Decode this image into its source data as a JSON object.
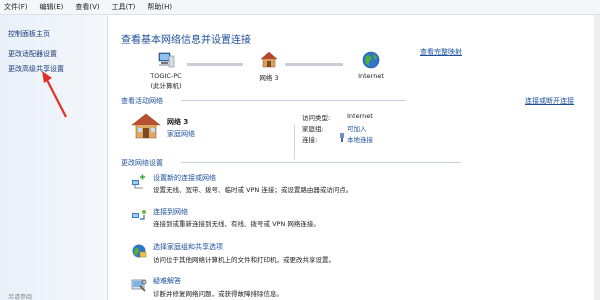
{
  "menu": {
    "file": "文件(F)",
    "edit": "编辑(E)",
    "view": "查看(V)",
    "tools": "工具(T)",
    "help": "帮助(H)"
  },
  "sidebar": {
    "home": "控制面板主页",
    "adapter": "更改适配器设置",
    "advanced_sharing": "更改高级共享设置",
    "see_also": "另请参阅"
  },
  "main": {
    "title": "查看基本网络信息并设置连接",
    "full_map": "查看完整映射",
    "nodes": {
      "pc_name": "TOGIC-PC",
      "pc_sub": "(此计算机)",
      "network": "网络  3",
      "internet": "Internet"
    },
    "active_section": "查看活动网络",
    "connect_disconnect": "连接或断开连接",
    "active_network": {
      "name": "网络  3",
      "type": "家庭网络",
      "access_type_label": "访问类型:",
      "access_type_value": "Internet",
      "homegroup_label": "家庭组:",
      "homegroup_value": "可加入",
      "connection_label": "连接:",
      "connection_value": "本地连接"
    },
    "change_section": "更改网络设置",
    "tasks": [
      {
        "title": "设置新的连接或网络",
        "desc": "设置无线、宽带、拨号、临时或 VPN 连接；或设置路由器或访问点。"
      },
      {
        "title": "连接到网络",
        "desc": "连接到或重新连接到无线、有线、拨号或 VPN 网络连接。"
      },
      {
        "title": "选择家庭组和共享选项",
        "desc": "访问位于其他网络计算机上的文件和打印机，或更改共享设置。"
      },
      {
        "title": "疑难解答",
        "desc": "诊断并修复网络问题，或获得故障排除信息。"
      }
    ]
  }
}
